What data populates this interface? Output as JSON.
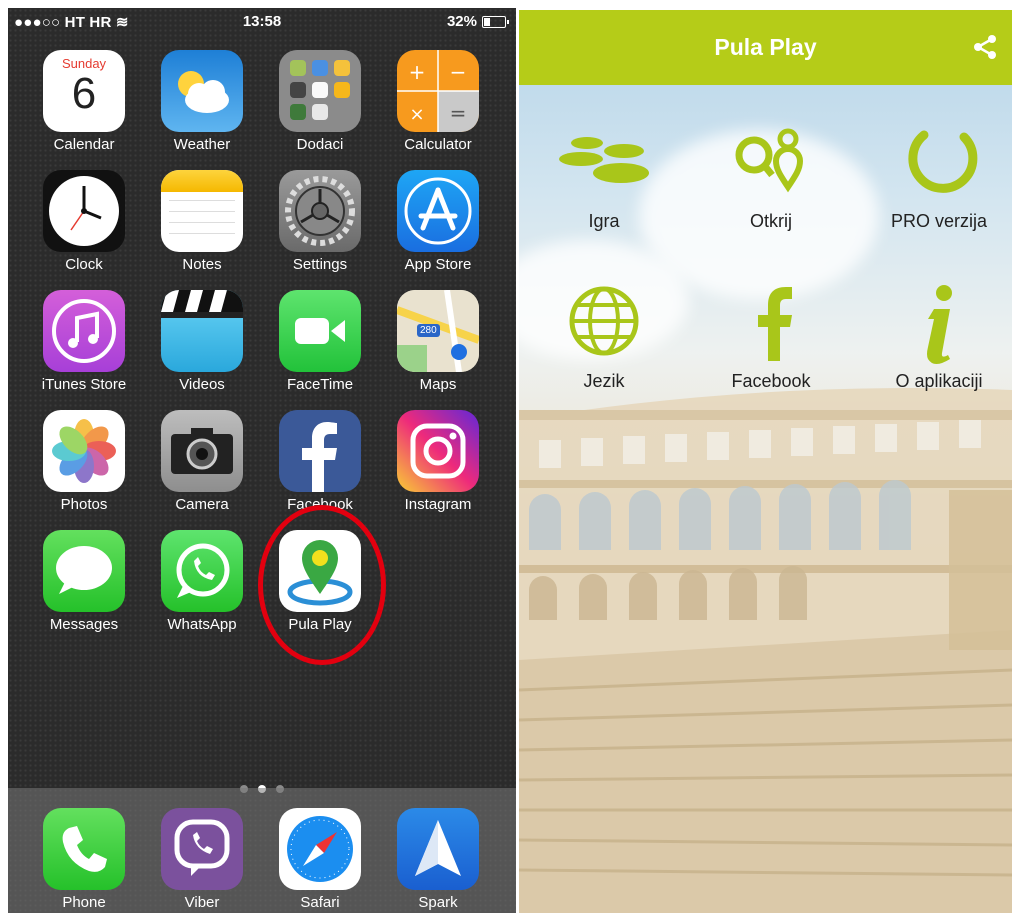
{
  "ios": {
    "status": {
      "carrier": "●●●○○ HT HR",
      "wifi_glyph": "≋",
      "time": "13:58",
      "battery_percent": "32%",
      "battery_level": 0.32
    },
    "apps": [
      {
        "label": "Calendar",
        "icon": "calendar-icon",
        "day": "Sunday",
        "date": "6"
      },
      {
        "label": "Weather",
        "icon": "weather-icon"
      },
      {
        "label": "Dodaci",
        "icon": "folder-icon"
      },
      {
        "label": "Calculator",
        "icon": "calculator-icon"
      },
      {
        "label": "Clock",
        "icon": "clock-icon"
      },
      {
        "label": "Notes",
        "icon": "notes-icon"
      },
      {
        "label": "Settings",
        "icon": "settings-gear-icon"
      },
      {
        "label": "App Store",
        "icon": "app-store-icon"
      },
      {
        "label": "iTunes Store",
        "icon": "music-note-icon"
      },
      {
        "label": "Videos",
        "icon": "clapperboard-icon"
      },
      {
        "label": "FaceTime",
        "icon": "video-camera-icon"
      },
      {
        "label": "Maps",
        "icon": "map-icon",
        "road": "280"
      },
      {
        "label": "Photos",
        "icon": "photos-flower-icon"
      },
      {
        "label": "Camera",
        "icon": "camera-icon"
      },
      {
        "label": "Facebook",
        "icon": "facebook-icon"
      },
      {
        "label": "Instagram",
        "icon": "instagram-icon"
      },
      {
        "label": "Messages",
        "icon": "speech-bubble-icon"
      },
      {
        "label": "WhatsApp",
        "icon": "whatsapp-icon"
      },
      {
        "label": "Pula Play",
        "icon": "map-pin-icon"
      }
    ],
    "page_dots": 3,
    "active_dot": 1,
    "dock": [
      {
        "label": "Phone",
        "icon": "phone-icon"
      },
      {
        "label": "Viber",
        "icon": "viber-icon"
      },
      {
        "label": "Safari",
        "icon": "compass-icon"
      },
      {
        "label": "Spark",
        "icon": "paper-plane-icon"
      }
    ],
    "highlight_color": "#e3000f"
  },
  "pula": {
    "title": "Pula Play",
    "share_icon": "share-icon",
    "accent": "#b5cc18",
    "menu": [
      {
        "label": "Igra",
        "icon": "stepping-stones-icon"
      },
      {
        "label": "Otkrij",
        "icon": "location-pins-icon"
      },
      {
        "label": "PRO verzija",
        "icon": "ring-icon"
      },
      {
        "label": "Jezik",
        "icon": "globe-icon"
      },
      {
        "label": "Facebook",
        "icon": "facebook-f-icon"
      },
      {
        "label": "O aplikaciji",
        "icon": "info-icon"
      }
    ]
  }
}
